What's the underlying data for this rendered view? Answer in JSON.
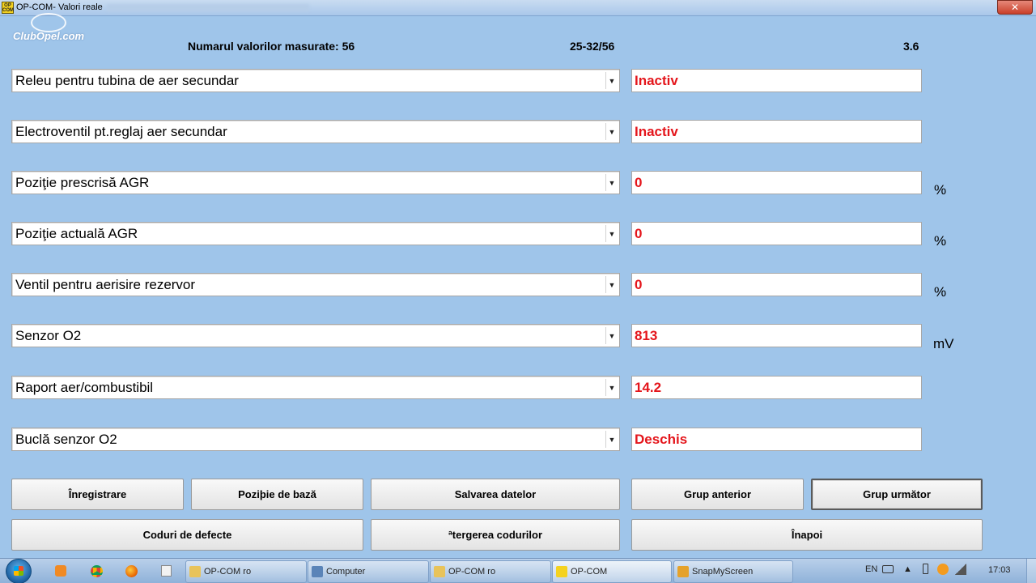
{
  "window": {
    "title": "OP-COM- Valori reale",
    "app_icon_text": "OP COM",
    "close_label": "✕"
  },
  "brand": {
    "text": "ClubOpel.com"
  },
  "header": {
    "count_label": "Numarul valorilor masurate: 56",
    "range": "25-32/56",
    "version": "3.6"
  },
  "rows": [
    {
      "label": "Releu pentru tubina de aer secundar",
      "value": "Inactiv",
      "unit": ""
    },
    {
      "label": "Electroventil pt.reglaj aer secundar",
      "value": "Inactiv",
      "unit": ""
    },
    {
      "label": "Poziţie prescrisă AGR",
      "value": "0",
      "unit": "%"
    },
    {
      "label": "Poziţie actuală AGR",
      "value": "0",
      "unit": "%"
    },
    {
      "label": "Ventil pentru aerisire rezervor",
      "value": "0",
      "unit": "%"
    },
    {
      "label": "Senzor O2",
      "value": "813",
      "unit": "mV"
    },
    {
      "label": "Raport aer/combustibil",
      "value": "14.2",
      "unit": ""
    },
    {
      "label": "Buclă senzor O2",
      "value": "Deschis",
      "unit": ""
    }
  ],
  "buttons": {
    "record": "Înregistrare",
    "base_position": "Poziþie de bază",
    "save_data": "Salvarea datelor",
    "prev_group": "Grup anterior",
    "next_group": "Grup următor",
    "fault_codes": "Coduri de defecte",
    "clear_codes": "ªtergerea codurilor",
    "back": "Înapoi"
  },
  "taskbar": {
    "items": [
      "OP-COM ro",
      "Computer",
      "OP-COM ro",
      "OP-COM",
      "SnapMyScreen"
    ],
    "language": "EN",
    "clock": "17:03"
  },
  "colors": {
    "value_text": "#e4151b",
    "background": "#9fc5ea"
  }
}
